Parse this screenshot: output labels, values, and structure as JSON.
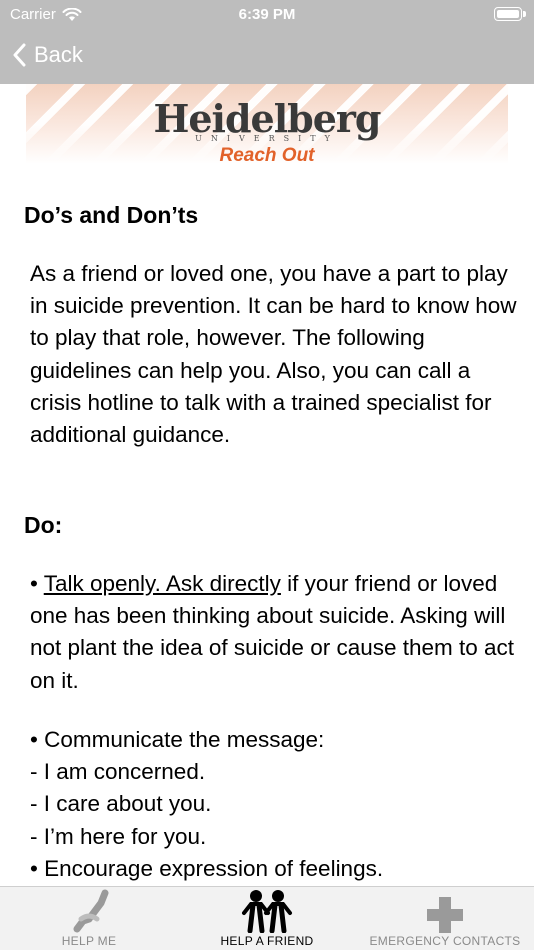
{
  "status_bar": {
    "carrier": "Carrier",
    "time": "6:39 PM",
    "wifi_icon": "wifi-icon",
    "battery_icon": "battery-icon"
  },
  "nav": {
    "back_label": "Back",
    "back_icon": "chevron-left-icon"
  },
  "banner": {
    "logo_word": "Heidelberg",
    "logo_sub": "UNIVERSITY",
    "reach_out": "Reach Out",
    "accent_color": "#e2622a"
  },
  "content": {
    "title": "Do’s and Don’ts",
    "intro": "As a friend or loved one, you have a part to play in suicide prevention. It can be hard to know how to play that role, however. The following guidelines can help you. Also, you can call a crisis hotline to talk with a trained specialist for additional guidance.",
    "do_heading": "Do:",
    "bullet1_prefix": "• ",
    "bullet1_underlined": "Talk openly. Ask directly",
    "bullet1_rest": " if your friend or loved one has been thinking about suicide. Asking will not plant the idea of suicide or cause them to act on it.",
    "bullet2": "• Communicate the message:",
    "sub_items": [
      "- I am concerned.",
      "- I care about you.",
      "- I’m here for you."
    ],
    "bullet3": "• Encourage expression of feelings."
  },
  "tabs": [
    {
      "label": "HELP ME",
      "icon": "helping-hands-icon",
      "active": false
    },
    {
      "label": "HELP A FRIEND",
      "icon": "people-icon",
      "active": true
    },
    {
      "label": "EMERGENCY CONTACTS",
      "icon": "plus-cross-icon",
      "active": false
    }
  ]
}
